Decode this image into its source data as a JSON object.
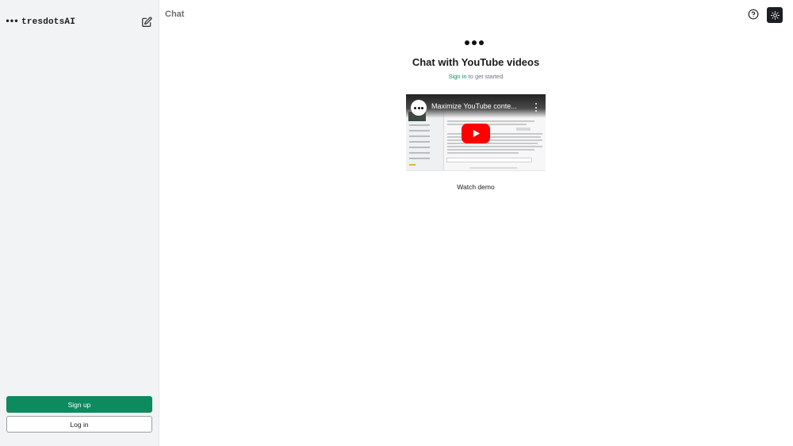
{
  "sidebar": {
    "brand_name": "tresdotsAI",
    "signup_label": "Sign up",
    "login_label": "Log in"
  },
  "header": {
    "title": "Chat"
  },
  "main": {
    "heading": "Chat with YouTube videos",
    "signin_link": "Sign in",
    "signin_suffix": " to get started",
    "video_title": "Maximize YouTube conte...",
    "watch_demo": "Watch demo"
  },
  "icons": {
    "brand": "three-dots-logo-icon",
    "new_chat": "edit-icon",
    "help": "question-circle-icon",
    "theme": "sun-icon",
    "play": "youtube-play-icon"
  },
  "colors": {
    "accent": "#0e8a5f",
    "sidebar_bg": "#f2f3f4",
    "theme_button_bg": "#1c1f22",
    "youtube_red": "#ff0000"
  }
}
